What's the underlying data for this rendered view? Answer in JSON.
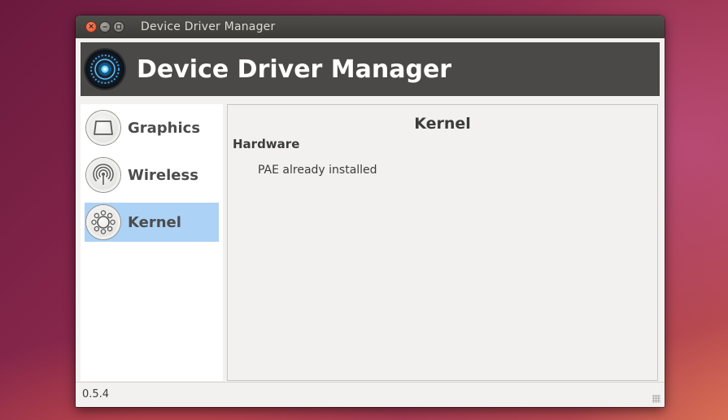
{
  "window": {
    "title": "Device Driver Manager",
    "close_glyph": "×"
  },
  "banner": {
    "title": "Device Driver Manager",
    "logo_icon": "driver-manager-logo-icon"
  },
  "sidebar": {
    "items": [
      {
        "label": "Graphics",
        "icon": "monitor-icon",
        "selected": false
      },
      {
        "label": "Wireless",
        "icon": "wireless-signal-icon",
        "selected": false
      },
      {
        "label": "Kernel",
        "icon": "kernel-chip-icon",
        "selected": true
      }
    ]
  },
  "content": {
    "title": "Kernel",
    "section": "Hardware",
    "status": "PAE already installed"
  },
  "statusbar": {
    "version": "0.5.4"
  },
  "colors": {
    "selection": "#acd2f5",
    "banner_bg": "#4a4947",
    "titlebar_bg": "#3c3b37",
    "close_button": "#e4522b"
  }
}
